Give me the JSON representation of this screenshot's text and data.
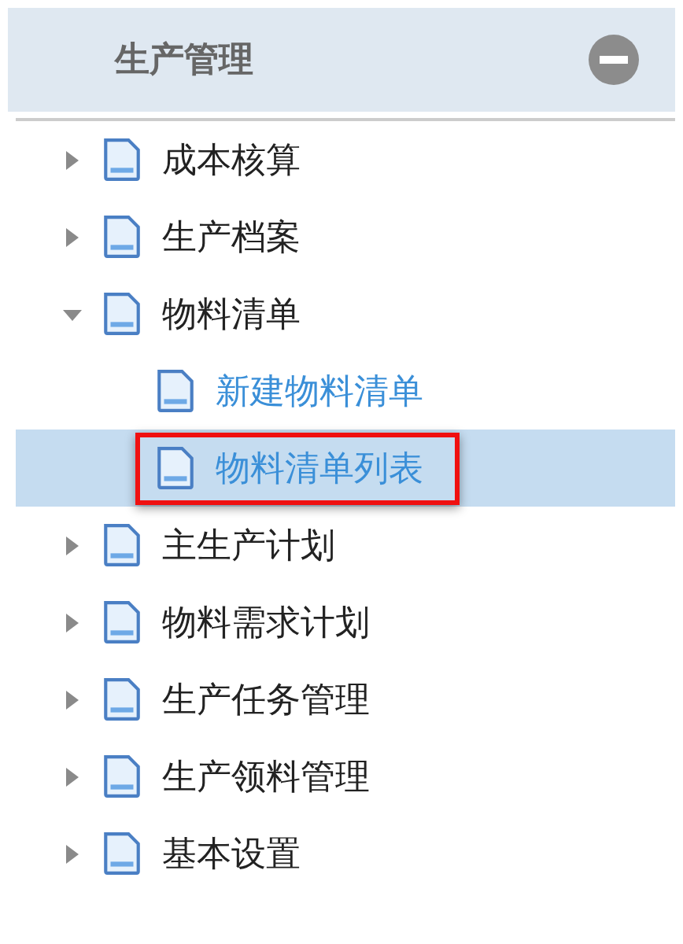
{
  "panel": {
    "title": "生产管理",
    "collapsed": false
  },
  "tree": [
    {
      "label": "成本核算",
      "expanded": false,
      "selected": false
    },
    {
      "label": "生产档案",
      "expanded": false,
      "selected": false
    },
    {
      "label": "物料清单",
      "expanded": true,
      "selected": false,
      "children": [
        {
          "label": "新建物料清单",
          "selected": false,
          "highlighted": false
        },
        {
          "label": "物料清单列表",
          "selected": true,
          "highlighted": true
        }
      ]
    },
    {
      "label": "主生产计划",
      "expanded": false,
      "selected": false
    },
    {
      "label": "物料需求计划",
      "expanded": false,
      "selected": false
    },
    {
      "label": "生产任务管理",
      "expanded": false,
      "selected": false
    },
    {
      "label": "生产领料管理",
      "expanded": false,
      "selected": false
    },
    {
      "label": "基本设置",
      "expanded": false,
      "selected": false
    }
  ]
}
